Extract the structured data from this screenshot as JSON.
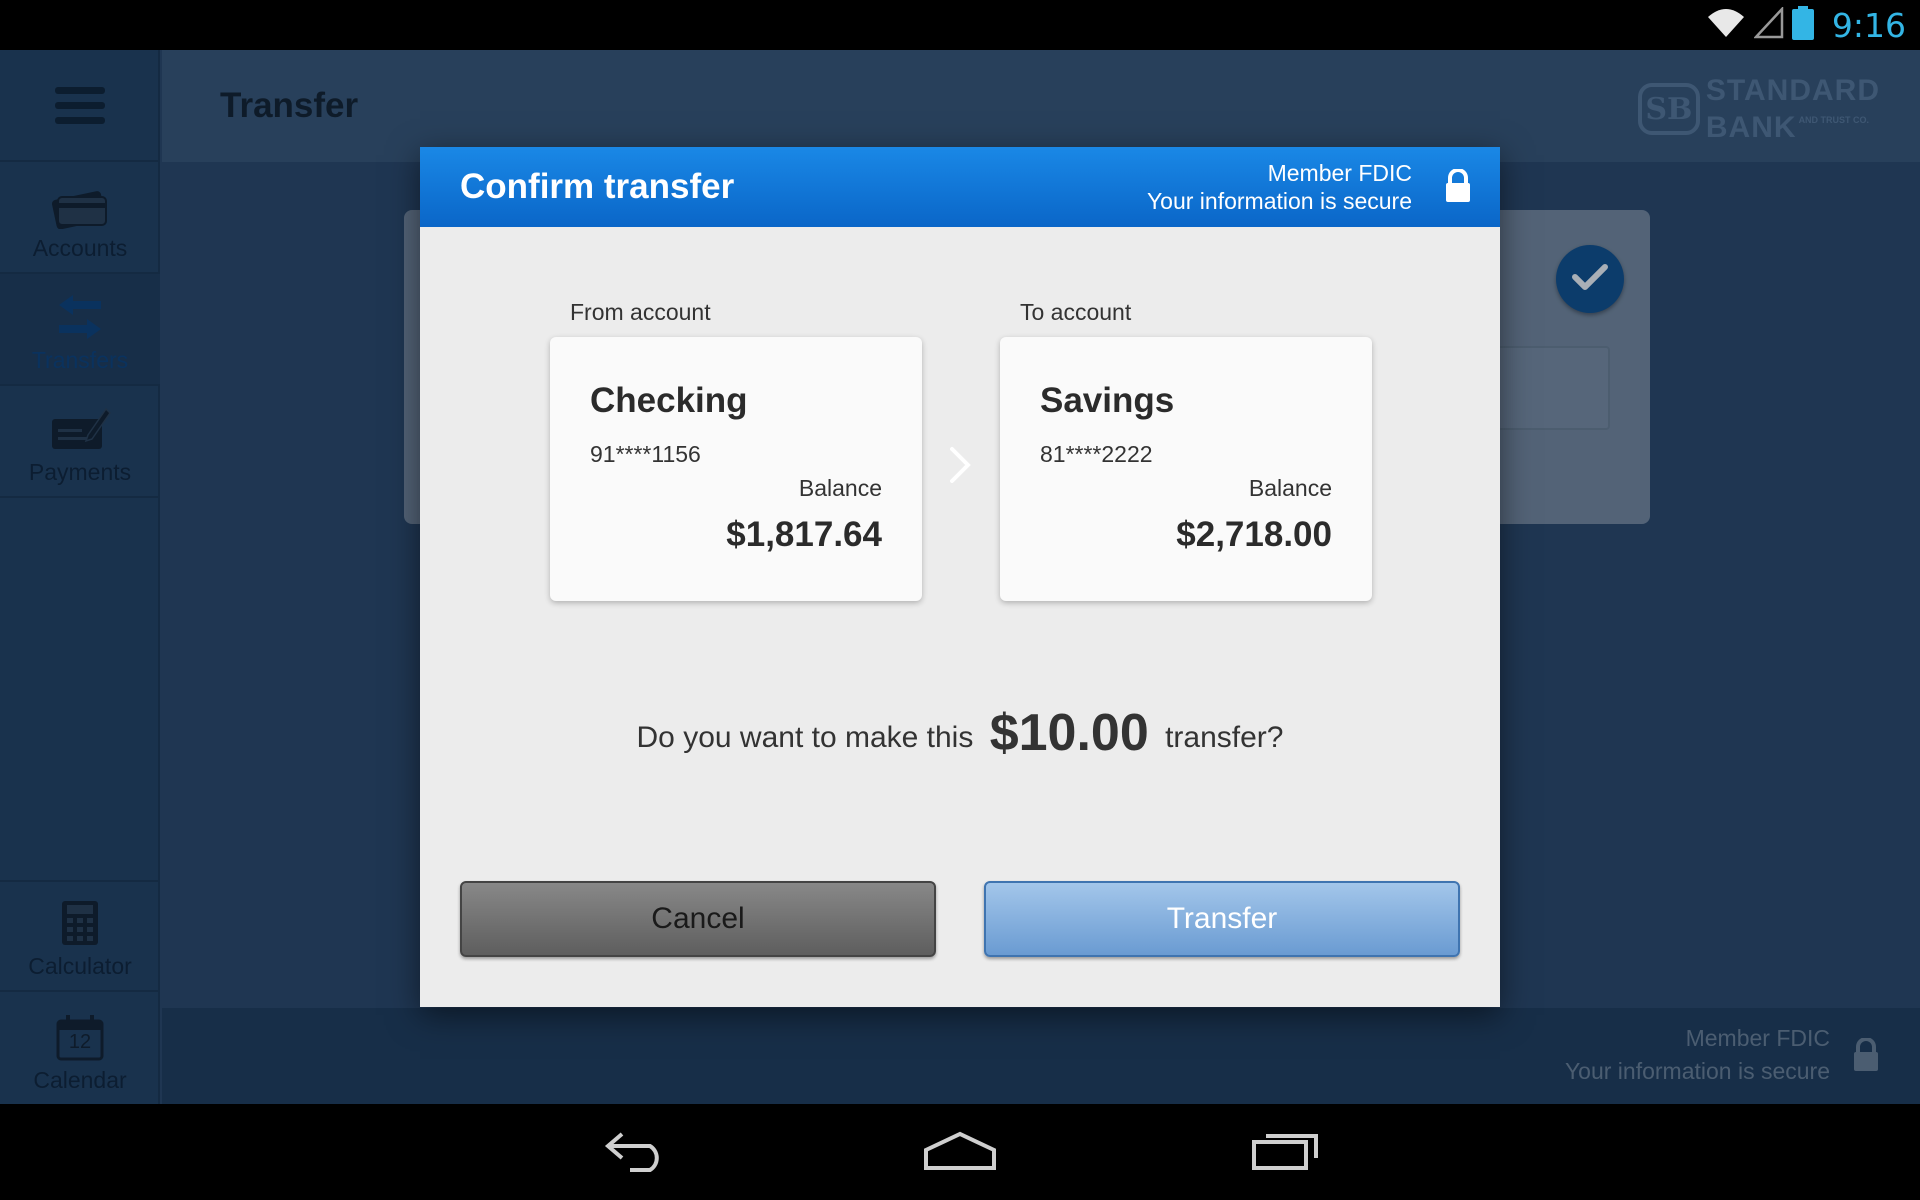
{
  "status_bar": {
    "time": "9:16"
  },
  "sidebar": {
    "items": [
      {
        "label": "Accounts",
        "icon": "credit-card-icon",
        "active": false
      },
      {
        "label": "Transfers",
        "icon": "transfer-arrows-icon",
        "active": true
      },
      {
        "label": "Payments",
        "icon": "check-pen-icon",
        "active": false
      }
    ],
    "bottom_items": [
      {
        "label": "Calculator",
        "icon": "calculator-icon"
      },
      {
        "label": "Calendar",
        "icon": "calendar-icon",
        "day": "12"
      }
    ]
  },
  "header": {
    "title": "Transfer",
    "brand": {
      "badge": "SB",
      "line1": "STANDARD",
      "line2": "BANK",
      "line2_small": "AND TRUST CO."
    }
  },
  "footer": {
    "line1": "Member FDIC",
    "line2": "Your information is secure"
  },
  "dialog": {
    "title": "Confirm transfer",
    "secure_line1": "Member FDIC",
    "secure_line2": "Your information is secure",
    "from": {
      "label": "From account",
      "name": "Checking",
      "number": "91****1156",
      "balance_label": "Balance",
      "balance": "$1,817.64"
    },
    "to": {
      "label": "To account",
      "name": "Savings",
      "number": "81****2222",
      "balance_label": "Balance",
      "balance": "$2,718.00"
    },
    "question_pre": "Do you want to make this",
    "amount": "$10.00",
    "question_post": "transfer?",
    "cancel_label": "Cancel",
    "transfer_label": "Transfer"
  },
  "colors": {
    "accent": "#33b5e5",
    "dialog_header": "#0a66c8",
    "transfer_button": "#6a9bd2"
  }
}
